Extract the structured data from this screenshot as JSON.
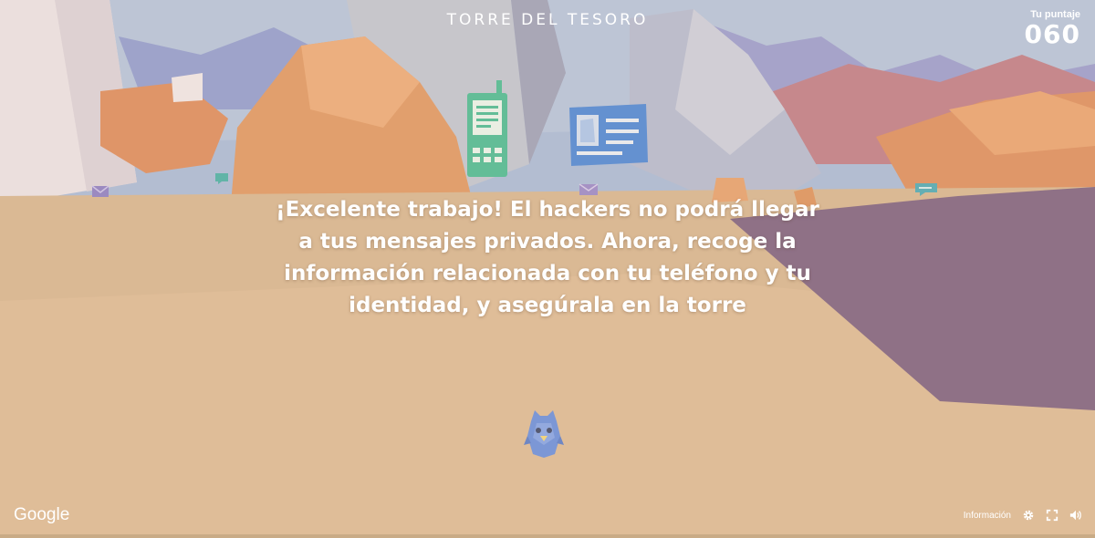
{
  "game": {
    "title": "TORRE DEL TESORO",
    "score_label": "Tu puntaje",
    "score_value": "060",
    "message": "¡Excelente trabajo! El hackers no podrá llegar a tus mensajes privados. Ahora, recoge la información relacionada con tu teléfono y tu identidad, y asegúrala en la torre"
  },
  "footer": {
    "brand": "Google",
    "info_label": "Información",
    "icons": [
      "gear-icon",
      "fullscreen-icon",
      "speaker-icon"
    ]
  },
  "colors": {
    "phone_item": "#2db38a",
    "id_card_item": "#2f76d8",
    "player": "#4f7fe0",
    "purple_shadow": "#6a4a72"
  }
}
